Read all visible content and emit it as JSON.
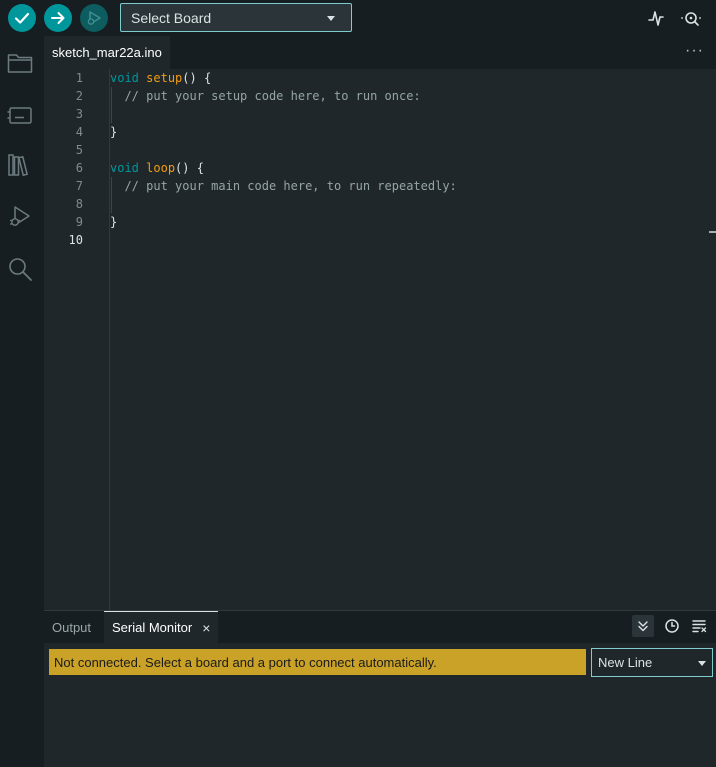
{
  "toolbar": {
    "verify_icon": "check-icon",
    "upload_icon": "arrow-right-icon",
    "debug_icon": "debug-play-icon",
    "board_select": "Select Board",
    "plotter_icon": "serial-plotter-icon",
    "serial_icon": "serial-monitor-icon"
  },
  "sidebar": {
    "items": [
      {
        "icon": "folder-icon"
      },
      {
        "icon": "board-manager-icon"
      },
      {
        "icon": "library-icon"
      },
      {
        "icon": "debug-icon"
      },
      {
        "icon": "search-icon"
      }
    ]
  },
  "tabs": {
    "active": "sketch_mar22a.ino",
    "more": "···"
  },
  "editor": {
    "line_numbers": [
      "1",
      "2",
      "3",
      "4",
      "5",
      "6",
      "7",
      "8",
      "9",
      "10"
    ],
    "current_line": "10",
    "lines": [
      [
        {
          "t": "void",
          "c": "kw"
        },
        {
          "t": " ",
          "c": "pl"
        },
        {
          "t": "setup",
          "c": "fn"
        },
        {
          "t": "() {",
          "c": "pl"
        }
      ],
      [
        {
          "t": "  // put your setup code here, to run once:",
          "c": "cm"
        }
      ],
      [],
      [
        {
          "t": "}",
          "c": "pl"
        }
      ],
      [],
      [
        {
          "t": "void",
          "c": "kw"
        },
        {
          "t": " ",
          "c": "pl"
        },
        {
          "t": "loop",
          "c": "fn"
        },
        {
          "t": "() {",
          "c": "pl"
        }
      ],
      [
        {
          "t": "  // put your main code here, to run repeatedly:",
          "c": "cm"
        }
      ],
      [],
      [
        {
          "t": "}",
          "c": "pl"
        }
      ],
      []
    ]
  },
  "panel": {
    "tab_output": "Output",
    "tab_serial": "Serial Monitor",
    "close_glyph": "×",
    "status": "Not connected. Select a board and a port to connect automatically.",
    "line_ending": "New Line",
    "status_color": "#c9a227",
    "accent": "#00979c"
  }
}
